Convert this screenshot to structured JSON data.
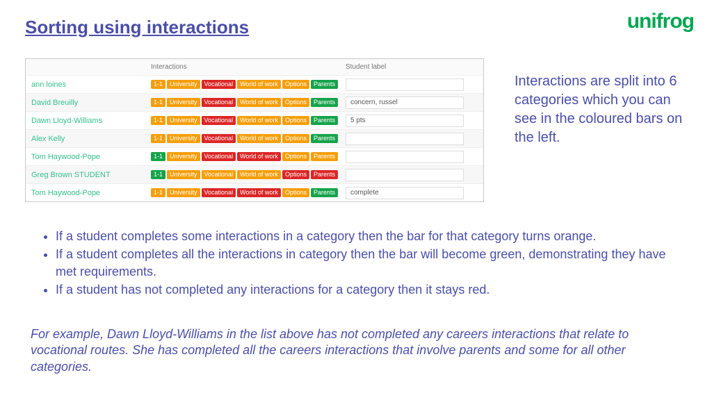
{
  "title": "Sorting using interactions",
  "logo": "unifrog",
  "headers": {
    "interactions": "Interactions",
    "label": "Student label"
  },
  "tag_labels": [
    "1-1",
    "University",
    "Vocational",
    "World of work",
    "Options",
    "Parents"
  ],
  "rows": [
    {
      "name": "ann loines",
      "colors": [
        "orange",
        "orange",
        "red",
        "orange",
        "orange",
        "green"
      ],
      "label": ""
    },
    {
      "name": "David Breuilly",
      "colors": [
        "orange",
        "orange",
        "red",
        "orange",
        "orange",
        "green"
      ],
      "label": "concern, russel"
    },
    {
      "name": "Dawn Lloyd-Williams",
      "colors": [
        "orange",
        "orange",
        "red",
        "orange",
        "orange",
        "green"
      ],
      "label": "5 pts"
    },
    {
      "name": "Alex Kelly",
      "colors": [
        "orange",
        "orange",
        "red",
        "orange",
        "orange",
        "green"
      ],
      "label": ""
    },
    {
      "name": "Tom Haywood-Pope",
      "colors": [
        "green",
        "orange",
        "red",
        "red",
        "orange",
        "orange"
      ],
      "label": ""
    },
    {
      "name": "Greg Brown STUDENT",
      "colors": [
        "green",
        "orange",
        "orange",
        "orange",
        "red",
        "red"
      ],
      "label": ""
    },
    {
      "name": "Tom Haywood-Pope",
      "colors": [
        "orange",
        "orange",
        "red",
        "red",
        "orange",
        "green"
      ],
      "label": "complete"
    }
  ],
  "side_text": "Interactions are split into 6 categories which you can see in the coloured bars on the left.",
  "bullets": [
    "If a student completes some interactions in a category then the bar for that category turns orange.",
    "If a student completes all the interactions in category then the bar will become green, demonstrating they have met requirements.",
    "If a student has not completed any interactions for a category then it stays red."
  ],
  "example": "For example, Dawn Lloyd-Williams in the list above has not completed any careers interactions that relate to vocational routes. She has completed all the careers interactions that involve parents and some for all other categories."
}
